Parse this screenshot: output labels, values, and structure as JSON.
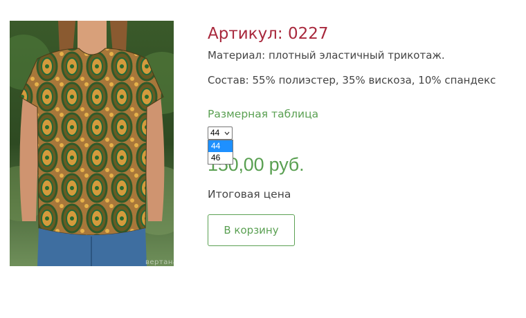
{
  "product": {
    "title": "Артикул: 0227",
    "material": "Материал: плотный эластичный трикотаж.",
    "composition": "Состав: 55% полиэстер, 35% вискоза, 10% спандекс",
    "image_watermark": "вертана.рф"
  },
  "size_table_link": "Размерная таблица",
  "size_select": {
    "selected": "44",
    "options": [
      "44",
      "46"
    ],
    "highlighted_option": "44"
  },
  "price": "150,00 руб.",
  "total_label": "Итоговая цена",
  "cart_button": "В корзину",
  "colors": {
    "title": "#a8283c",
    "accent_green": "#5aa052",
    "text": "#444444",
    "option_highlight": "#1e90ff"
  },
  "icons": {
    "select_chevron": "chevron-down-icon"
  }
}
